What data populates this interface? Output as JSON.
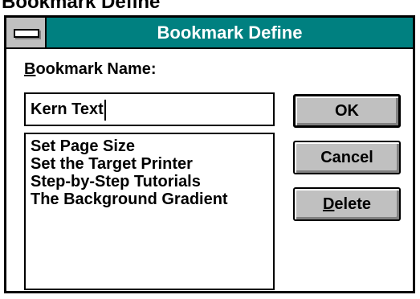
{
  "page": {
    "heading": "Bookmark Define"
  },
  "dialog": {
    "title": "Bookmark Define",
    "system_menu_icon": "control-menu-icon",
    "colors": {
      "titlebar": "#008080",
      "button_face": "#c0c0c0",
      "window_bg": "#ffffff"
    },
    "name_label": {
      "hotkey": "B",
      "rest": "ookmark Name:"
    },
    "name_value": "Kern Text",
    "bookmarks": [
      "Set Page Size",
      "Set the Target Printer",
      "Step-by-Step Tutorials",
      "The Background Gradient"
    ],
    "buttons": {
      "ok": "OK",
      "cancel": "Cancel",
      "delete_hotkey": "D",
      "delete_rest": "elete"
    }
  }
}
